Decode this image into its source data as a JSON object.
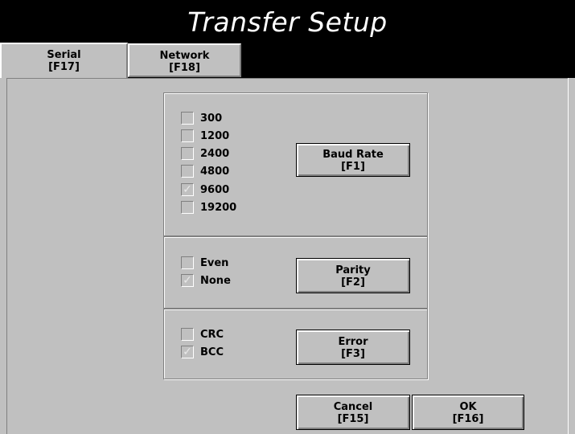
{
  "title": "Transfer Setup",
  "tabs": [
    {
      "label": "Serial",
      "key": "[F17]"
    },
    {
      "label": "Network",
      "key": "[F18]"
    }
  ],
  "baud": {
    "options": [
      {
        "label": "300",
        "checked": false
      },
      {
        "label": "1200",
        "checked": false
      },
      {
        "label": "2400",
        "checked": false
      },
      {
        "label": "4800",
        "checked": false
      },
      {
        "label": "9600",
        "checked": true
      },
      {
        "label": "19200",
        "checked": false
      }
    ],
    "button": {
      "label": "Baud Rate",
      "key": "[F1]"
    }
  },
  "parity": {
    "options": [
      {
        "label": "Even",
        "checked": false
      },
      {
        "label": "None",
        "checked": true
      }
    ],
    "button": {
      "label": "Parity",
      "key": "[F2]"
    }
  },
  "error": {
    "options": [
      {
        "label": "CRC",
        "checked": false
      },
      {
        "label": "BCC",
        "checked": true
      }
    ],
    "button": {
      "label": "Error",
      "key": "[F3]"
    }
  },
  "cancel": {
    "label": "Cancel",
    "key": "[F15]"
  },
  "ok": {
    "label": "OK",
    "key": "[F16]"
  },
  "check_glyph": "✓"
}
